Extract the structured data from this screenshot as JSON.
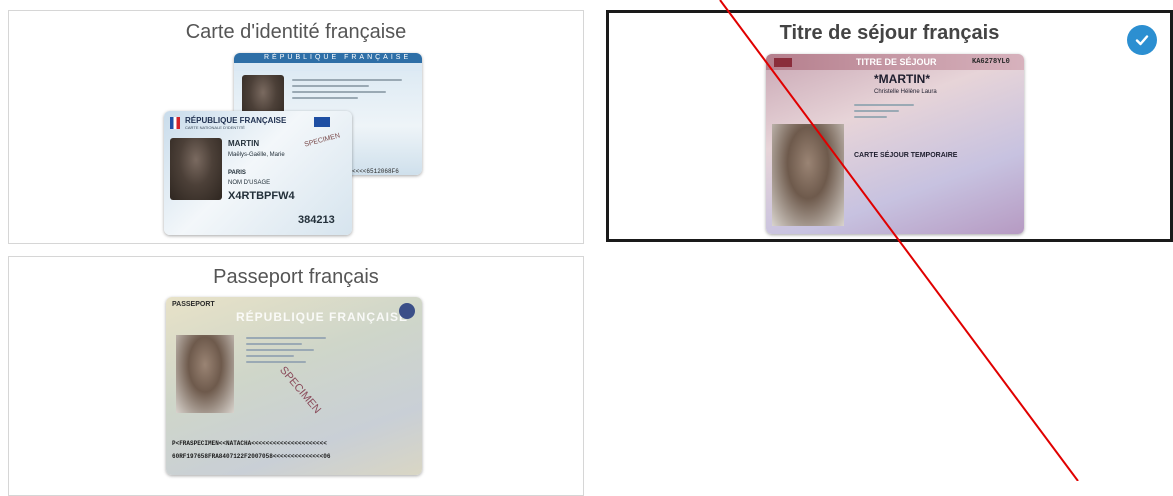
{
  "documents": [
    {
      "title": "Carte d'identité française",
      "selected": false,
      "image": {
        "back_header": "RÉPUBLIQUE FRANÇAISE",
        "front_header": "RÉPUBLIQUE FRANÇAISE",
        "front_subheader": "CARTE NATIONALE D'IDENTITÉ",
        "surname": "MARTIN",
        "given_names": "Maëlys-Gaëlle, Marie",
        "place": "PARIS",
        "nom_usage_label": "NOM D'USAGE",
        "doc_number": "X4RTBPFW4",
        "can": "384213",
        "specimen": "SPECIMEN",
        "mrz_fragment": "<<<<6512068F6"
      }
    },
    {
      "title": "Titre de séjour français",
      "selected": true,
      "image": {
        "header": "TITRE DE SÉJOUR",
        "number": "KA6278YL0",
        "surname": "*MARTIN*",
        "given_names": "Christelle Hélène Laura",
        "card_type": "CARTE SÉJOUR TEMPORAIRE"
      }
    },
    {
      "title": "Passeport français",
      "selected": false,
      "image": {
        "label": "PASSEPORT",
        "header": "RÉPUBLIQUE FRANÇAISE",
        "specimen": "SPECIMEN",
        "mrz_line1": "P<FRASPECIMEN<<NATACHA<<<<<<<<<<<<<<<<<<<<<",
        "mrz_line2": "60RF197658FRA8407122F2007058<<<<<<<<<<<<<<06"
      }
    }
  ],
  "colors": {
    "check": "#2c8fd1",
    "annotation_line": "#e00000",
    "selected_border": "#1a1a1a"
  }
}
